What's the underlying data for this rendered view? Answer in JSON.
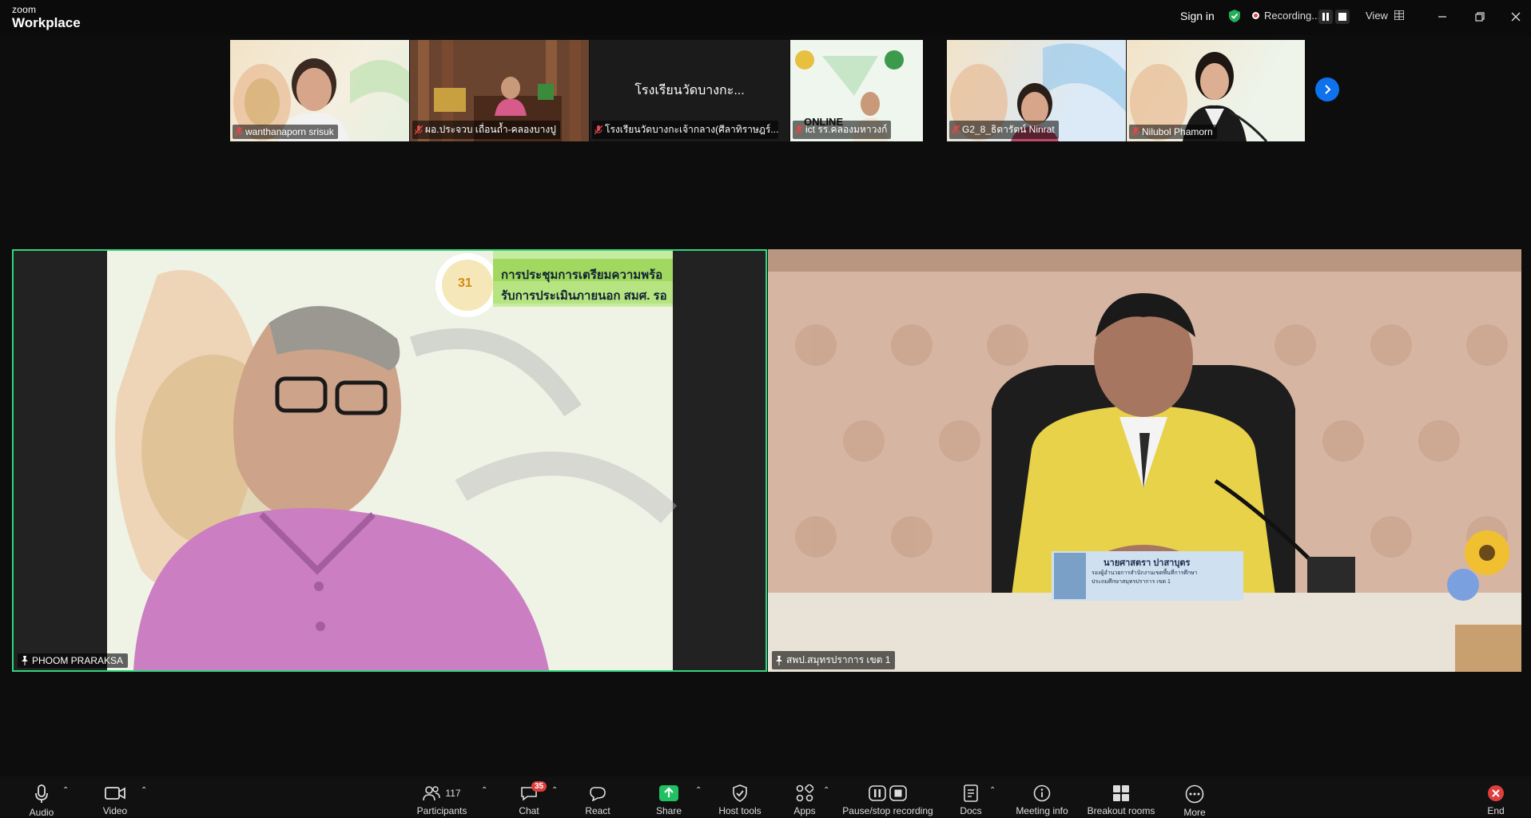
{
  "app": {
    "logo_top": "zoom",
    "logo_bottom": "Workplace"
  },
  "topbar": {
    "sign_in": "Sign in",
    "recording_label": "Recording...",
    "view_label": "View"
  },
  "strip": {
    "participants": [
      {
        "name": "wanthanaporn srisuk"
      },
      {
        "name": "ผอ.ประจวบ เถื่อนถ้ำ-คลองบางปู"
      },
      {
        "name": "โรงเรียนวัดบางกะเจ้ากลาง(ศีลาทิราษฎร์...",
        "placeholder": "โรงเรียนวัดบางกะ..."
      },
      {
        "name": "ict รร.คลองมหาวงก์",
        "overlay": "ONLINE"
      },
      {
        "name": "G2_8_ธิดารัตน์ Ninrat"
      },
      {
        "name": "Nilubol Phamorn"
      }
    ]
  },
  "speakers": {
    "left": {
      "name": "PHOOM PRARAKSA",
      "banner_line1": "การประชุมการเตรียมความพร้อ",
      "banner_line2": "รับการประเมินภายนอก สมศ. รอ",
      "badge_number": "31"
    },
    "right": {
      "name": "สพป.สมุทรปราการ เขต 1",
      "nameplate_line1": "นายศาสตรา ปาสาบุตร",
      "nameplate_line2": "รองผู้อำนวยการสำนักงานเขตพื้นที่การศึกษา",
      "nameplate_line3": "ประถมศึกษาสมุทรปราการ เขต 1"
    }
  },
  "toolbar": {
    "audio": "Audio",
    "video": "Video",
    "participants": "Participants",
    "participants_count": "117",
    "chat": "Chat",
    "chat_badge": "35",
    "react": "React",
    "share": "Share",
    "host_tools": "Host tools",
    "apps": "Apps",
    "pause_stop": "Pause/stop recording",
    "docs": "Docs",
    "meeting_info": "Meeting info",
    "breakout": "Breakout rooms",
    "more": "More",
    "end": "End"
  },
  "colors": {
    "accent": "#0e72ed",
    "active_border": "#2fd67d",
    "share_green": "#21c063",
    "end_red": "#e03e3e"
  }
}
